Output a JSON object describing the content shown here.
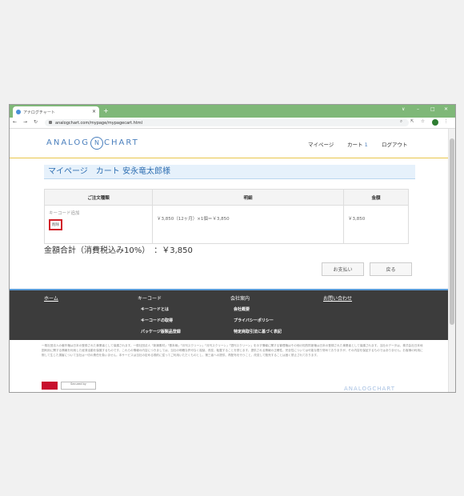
{
  "browser": {
    "tab_title": "アナログチャート",
    "tab_close": "×",
    "new_tab": "+",
    "url": "analogchart.com/mypage/mypagecart.html"
  },
  "header": {
    "logo_left": "ANALOG",
    "logo_mark": "N",
    "logo_right": "CHART",
    "nav": {
      "mypage": "マイページ",
      "cart": "カート",
      "cart_count": "1",
      "logout": "ログアウト"
    }
  },
  "main": {
    "title": "マイページ　カート 安永竜太郎様",
    "table": {
      "headers": [
        "ご注文種類",
        "明細",
        "金額"
      ],
      "rows": [
        {
          "type": "キーコード追加",
          "delete_label": "削除",
          "detail": "￥3,850（12ヶ月）×1個＝￥3,850",
          "amount": "￥3,850"
        }
      ]
    },
    "total": "金額合計（消費税込み10%）　：￥3,850",
    "buttons": {
      "pay": "お支払い",
      "back": "戻る"
    }
  },
  "footer": {
    "col1": {
      "title": "ホーム"
    },
    "col2": {
      "title": "キーコード",
      "links": [
        "キーコードとは",
        "キーコードの取得",
        "パッケージ版製品登録"
      ]
    },
    "col3": {
      "title": "会社案内",
      "links": [
        "会社概要",
        "プライバシーポリシー",
        "特定商取引法に基づく表記"
      ]
    },
    "col4": {
      "title": "お問い合わせ"
    }
  },
  "legal": "一般社団法人の著作権は日本の登録された事業者として保護されます。一般社団法人「新潮素材」「基本線」「月刊スクリーン」「月刊スクリーン」「週刊スクリーン」を示す情報に関する管理権はその他の知的財産権は日本の登録された事業者として保護されます。当社のデータは、株式会社日本地図利用に関する情報を利用した経済活動を保護するものです。これらの情報の内容につきましては、当社の明確な許可なく複製、改変、転載することを禁じます。提供される情報の正確性、完全性については可能な限り努めておりますが、その内容を保証するものではありません。お客様の利用に際して生じた損害について当社は一切の責任を負いません。本サービスは当社の定める規約に従ってご利用いただくものとし、第三者への提供、再配布を行うこと、改変して販売することは固く禁止されております。",
  "badges": {
    "secure": "Secured by"
  },
  "footer_logo": "ANALOGCHART",
  "colors": {
    "tab_green": "#7fb878",
    "accent_blue": "#4a7fbd",
    "title_bg": "#e6f1fb",
    "footer_bg": "#3c3c3c",
    "delete_border": "#d2232a"
  },
  "icons": [
    "favicon-icon",
    "back-icon",
    "forward-icon",
    "reload-icon",
    "lock-icon",
    "search-icon",
    "share-icon",
    "star-icon",
    "profile-icon",
    "menu-icon",
    "minimize-icon",
    "maximize-icon",
    "close-window-icon"
  ]
}
